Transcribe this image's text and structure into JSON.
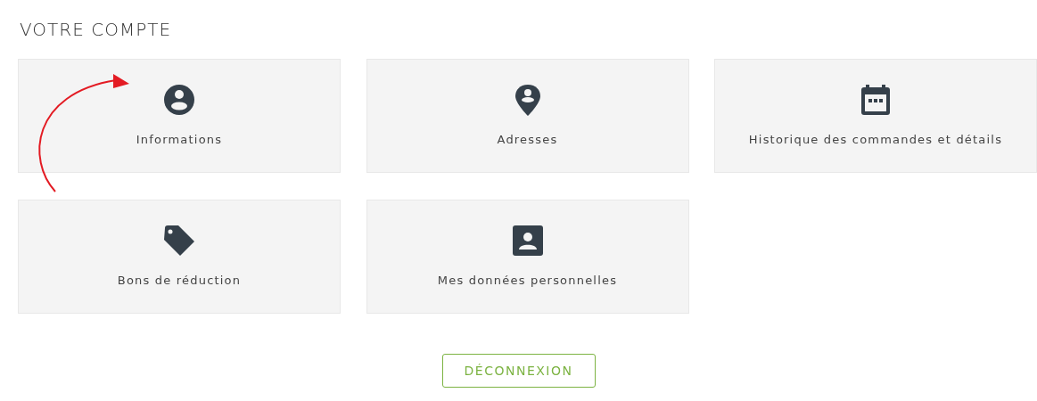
{
  "title": "VOTRE COMPTE",
  "cards": [
    {
      "label": "Informations",
      "kind": "user"
    },
    {
      "label": "Adresses",
      "kind": "pin"
    },
    {
      "label": "Historique des commandes et détails",
      "kind": "calendar"
    },
    {
      "label": "Bons de réduction",
      "kind": "tag"
    },
    {
      "label": "Mes données personnelles",
      "kind": "idcard"
    }
  ],
  "logout_button": "DÉCONNEXION"
}
